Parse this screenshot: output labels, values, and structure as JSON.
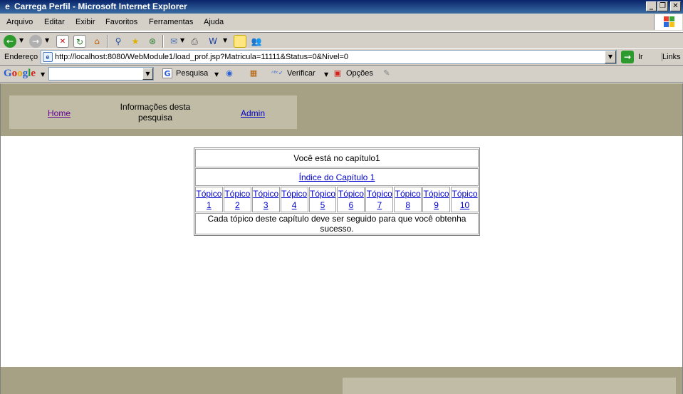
{
  "window": {
    "title": "Carrega Perfil - Microsoft Internet Explorer"
  },
  "menu": {
    "items": [
      "Arquivo",
      "Editar",
      "Exibir",
      "Favoritos",
      "Ferramentas",
      "Ajuda"
    ]
  },
  "address": {
    "label": "Endereço",
    "url": "http://localhost:8080/WebModule1/load_prof.jsp?Matricula=11111&Status=0&Nivel=0",
    "go_label": "Ir",
    "links_label": "Links"
  },
  "google_toolbar": {
    "logo": "Google",
    "search_value": "",
    "search_button": "Pesquisa",
    "verify_button": "Verificar",
    "options_button": "Opções"
  },
  "nav": {
    "home": "Home",
    "info": "Informações desta pesquisa",
    "admin": "Admin"
  },
  "content": {
    "chapter_text": "Você está no capítulo1",
    "index_link": "Índice do Capítulo 1",
    "topics": [
      {
        "word": "Tópico",
        "num": "1"
      },
      {
        "word": "Tópico",
        "num": "2"
      },
      {
        "word": "Tópico",
        "num": "3"
      },
      {
        "word": "Tópico",
        "num": "4"
      },
      {
        "word": "Tópico",
        "num": "5"
      },
      {
        "word": "Tópico",
        "num": "6"
      },
      {
        "word": "Tópico",
        "num": "7"
      },
      {
        "word": "Tópico",
        "num": "8"
      },
      {
        "word": "Tópico",
        "num": "9"
      },
      {
        "word": "Tópico",
        "num": "10"
      }
    ],
    "footer_text": "Cada tópico deste capítulo deve ser seguido para que você obtenha sucesso."
  }
}
